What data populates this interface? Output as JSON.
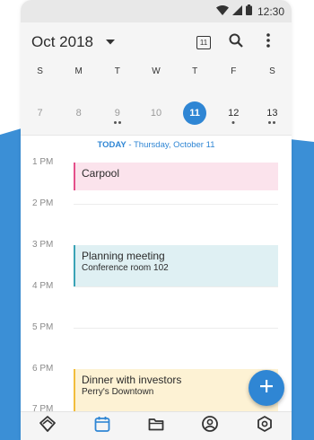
{
  "status_bar": {
    "time": "12:30"
  },
  "header": {
    "month": "Oct 2018",
    "today_button_day": "11"
  },
  "week": {
    "day_initials": [
      "S",
      "M",
      "T",
      "W",
      "T",
      "F",
      "S"
    ],
    "dates": [
      {
        "day": "7",
        "state": "past",
        "dots": 0
      },
      {
        "day": "8",
        "state": "past",
        "dots": 0
      },
      {
        "day": "9",
        "state": "past",
        "dots": 2
      },
      {
        "day": "10",
        "state": "past",
        "dots": 0
      },
      {
        "day": "11",
        "state": "selected",
        "dots": 0
      },
      {
        "day": "12",
        "state": "future",
        "dots": 1
      },
      {
        "day": "13",
        "state": "future",
        "dots": 2
      }
    ],
    "today_prefix": "TODAY",
    "today_text": " - Thursday, October 11"
  },
  "hours": [
    "1 PM",
    "2 PM",
    "3 PM",
    "4 PM",
    "5 PM",
    "6 PM",
    "7 PM"
  ],
  "events": [
    {
      "title": "Carpool",
      "subtitle": "",
      "color": "#e44f8a"
    },
    {
      "title": "Planning meeting",
      "subtitle": "Conference room 102",
      "color": "#3aa3b6"
    },
    {
      "title": "Dinner with investors",
      "subtitle": "Perry's Downtown",
      "color": "#f2bd3b"
    }
  ],
  "bottom_nav": {
    "items": [
      {
        "icon": "home-icon",
        "active": false
      },
      {
        "icon": "calendar-icon",
        "active": true
      },
      {
        "icon": "folder-icon",
        "active": false
      },
      {
        "icon": "account-icon",
        "active": false
      },
      {
        "icon": "settings-icon",
        "active": false
      }
    ]
  },
  "colors": {
    "accent": "#2f86d4",
    "background_wave": "#3b8fd6"
  }
}
